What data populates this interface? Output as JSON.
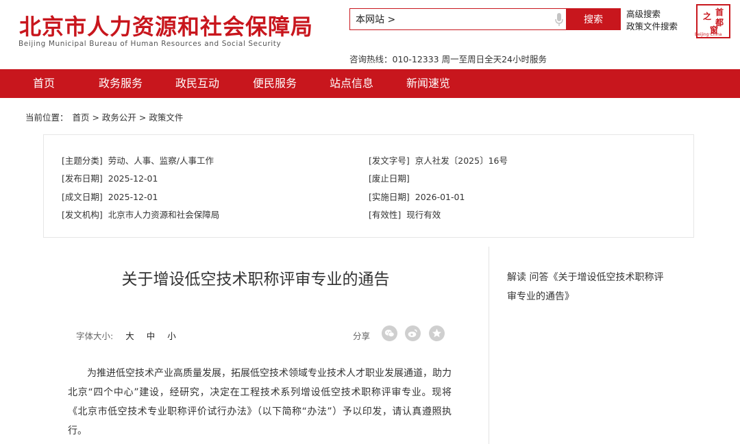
{
  "header": {
    "logo_cn": "北京市人力资源和社会保障局",
    "logo_en": "Beijing Municipal Bureau of Human Resources and Social Security",
    "search_scope": "本网站 >",
    "search_button": "搜索",
    "advanced_search": "高级搜索",
    "policy_search": "政策文件搜索",
    "hotline": "咨询热线：010-12333 周一至周日全天24小时服务",
    "seal_chars": [
      "首",
      "都",
      "之",
      "窗"
    ],
    "seal_sub": "Beijing·China"
  },
  "nav": {
    "items": [
      "首页",
      "政务服务",
      "政民互动",
      "便民服务",
      "站点信息",
      "新闻速览"
    ]
  },
  "breadcrumb": {
    "prefix": "当前位置：",
    "path": "首页 > 政务公开 > 政策文件"
  },
  "meta": {
    "left": [
      {
        "k": "[主题分类]",
        "v": "劳动、人事、监察/人事工作"
      },
      {
        "k": "[发布日期]",
        "v": "2025-12-01"
      },
      {
        "k": "[成文日期]",
        "v": "2025-12-01"
      },
      {
        "k": "[发文机构]",
        "v": "北京市人力资源和社会保障局"
      }
    ],
    "right": [
      {
        "k": "[发文字号]",
        "v": "京人社发〔2025〕16号"
      },
      {
        "k": "[废止日期]",
        "v": ""
      },
      {
        "k": "[实施日期]",
        "v": "2026-01-01"
      },
      {
        "k": "[有效性]",
        "v": "现行有效"
      }
    ]
  },
  "article": {
    "title": "关于增设低空技术职称评审专业的通告",
    "font_label": "字体大小:",
    "font_large": "大",
    "font_medium": "中",
    "font_small": "小",
    "share_label": "分享",
    "body": "为推进低空技术产业高质量发展，拓展低空技术领域专业技术人才职业发展通道，助力北京“四个中心”建设，经研究，决定在工程技术系列增设低空技术职称评审专业。现将《北京市低空技术专业职称评价试行办法》（以下简称“办法”）予以印发，请认真遵照执行。"
  },
  "sidebar": {
    "interpret": "解读 问答《关于增设低空技术职称评审专业的通告》"
  },
  "colors": {
    "brand_red": "#c8161d",
    "share_icon_gray": "#cfcfcf"
  },
  "icons": [
    "microphone-icon",
    "wechat-icon",
    "weibo-icon",
    "other-share-icon"
  ]
}
